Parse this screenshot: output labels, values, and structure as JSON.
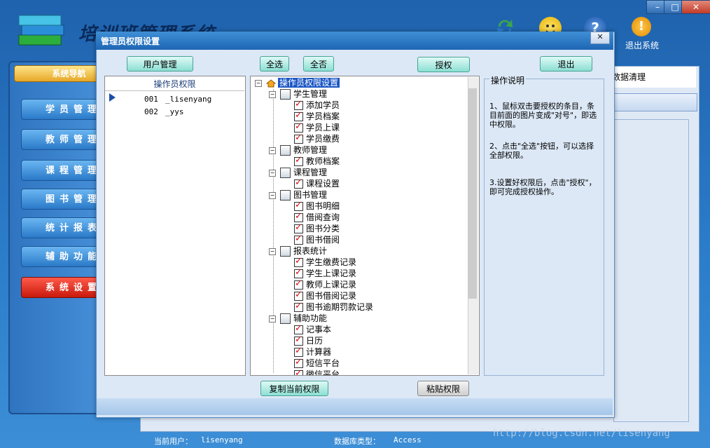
{
  "main": {
    "app_title": "培训班管理系统",
    "window_controls": [
      "–",
      "□",
      "✕"
    ],
    "exit_label": "退出系统",
    "sidebar_title": "系统导航",
    "nav_items": [
      "学员管理",
      "教师管理",
      "课程管理",
      "图书管理",
      "统计报表",
      "辅助功能",
      "系统设置"
    ],
    "active_nav": "系统设置",
    "right_header": "数据清理",
    "status_user_label": "当前用户：",
    "status_user_value": "lisenyang",
    "status_db_label": "数据库类型：",
    "status_db_value": "Access",
    "watermark": "http://blog.csdn.net/lisenyang"
  },
  "dialog": {
    "title": "管理员权限设置",
    "close": "✕",
    "buttons": {
      "user_manage": "用户管理",
      "select_all": "全选",
      "select_none": "全否",
      "authorize": "授权",
      "exit": "退出",
      "copy_rights": "复制当前权限",
      "paste_rights": "粘贴权限"
    },
    "operators_header": "操作员权限",
    "operators": [
      {
        "id": "001",
        "name": "_lisenyang"
      },
      {
        "id": "002",
        "name": "_yys"
      }
    ],
    "tree": {
      "root": "操作员权限设置",
      "groups": [
        {
          "label": "学生管理",
          "items": [
            "添加学员",
            "学员档案",
            "学员上课",
            "学员缴费"
          ]
        },
        {
          "label": "教师管理",
          "items": [
            "教师档案"
          ]
        },
        {
          "label": "课程管理",
          "items": [
            "课程设置"
          ]
        },
        {
          "label": "图书管理",
          "items": [
            "图书明细",
            "借阅查询",
            "图书分类",
            "图书借阅"
          ]
        },
        {
          "label": "报表统计",
          "items": [
            "学生缴费记录",
            "学生上课记录",
            "教师上课记录",
            "图书借阅记录",
            "图书逾期罚款记录"
          ]
        },
        {
          "label": "辅助功能",
          "items": [
            "记事本",
            "日历",
            "计算器",
            "短信平台",
            "微信平台"
          ]
        }
      ]
    },
    "help": {
      "title": "操作说明",
      "steps": [
        "1、鼠标双击要授权的条目，条目前面的图片变成\"对号\"，即选中权限。",
        "2、点击\"全选\"按钮，可以选择全部权限。",
        "3.设置好权限后，点击\"授权\"，即可完成授权操作。"
      ]
    }
  },
  "colors": {
    "main_bg": "#2b7cc9",
    "dialog_bg": "#dce8f6",
    "nav_active": "#c81a0d",
    "check": "#d01010",
    "selected": "#1a56c4"
  }
}
